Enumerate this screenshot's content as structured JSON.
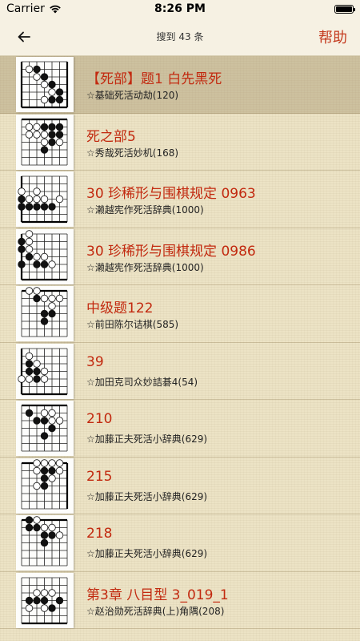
{
  "status_bar": {
    "carrier": "Carrier",
    "time": "8:26 PM",
    "battery_level": 1.0
  },
  "nav": {
    "title": "搜到 43 条",
    "help_label": "帮助",
    "back_icon": "arrow-left-icon"
  },
  "colors": {
    "accent": "#c43a1e",
    "title_red": "#c2290f",
    "paper": "#ece3c5"
  },
  "items": [
    {
      "title": "【死部】题1 白先黑死",
      "subtitle": "☆基础死活动劫(120)",
      "selected": true
    },
    {
      "title": "死之部5",
      "subtitle": "☆秀哉死活妙机(168)",
      "selected": false
    },
    {
      "title": "30 珍稀形与围棋规定 0963",
      "subtitle": "☆濑越宪作死活辞典(1000)",
      "selected": false
    },
    {
      "title": "30 珍稀形与围棋规定 0986",
      "subtitle": "☆濑越宪作死活辞典(1000)",
      "selected": false
    },
    {
      "title": "中级题122",
      "subtitle": "☆前田陈尔诘棋(585)",
      "selected": false
    },
    {
      "title": "39",
      "subtitle": "☆加田克司众妙詰碁4(54)",
      "selected": false
    },
    {
      "title": "210",
      "subtitle": "☆加藤正夫死活小辞典(629)",
      "selected": false
    },
    {
      "title": "215",
      "subtitle": "☆加藤正夫死活小辞典(629)",
      "selected": false
    },
    {
      "title": "218",
      "subtitle": "☆加藤正夫死活小辞典(629)",
      "selected": false
    },
    {
      "title": "第3章 八目型 3_019_1",
      "subtitle": "☆赵治勋死活辞典(上)角隅(208)",
      "selected": false
    }
  ]
}
